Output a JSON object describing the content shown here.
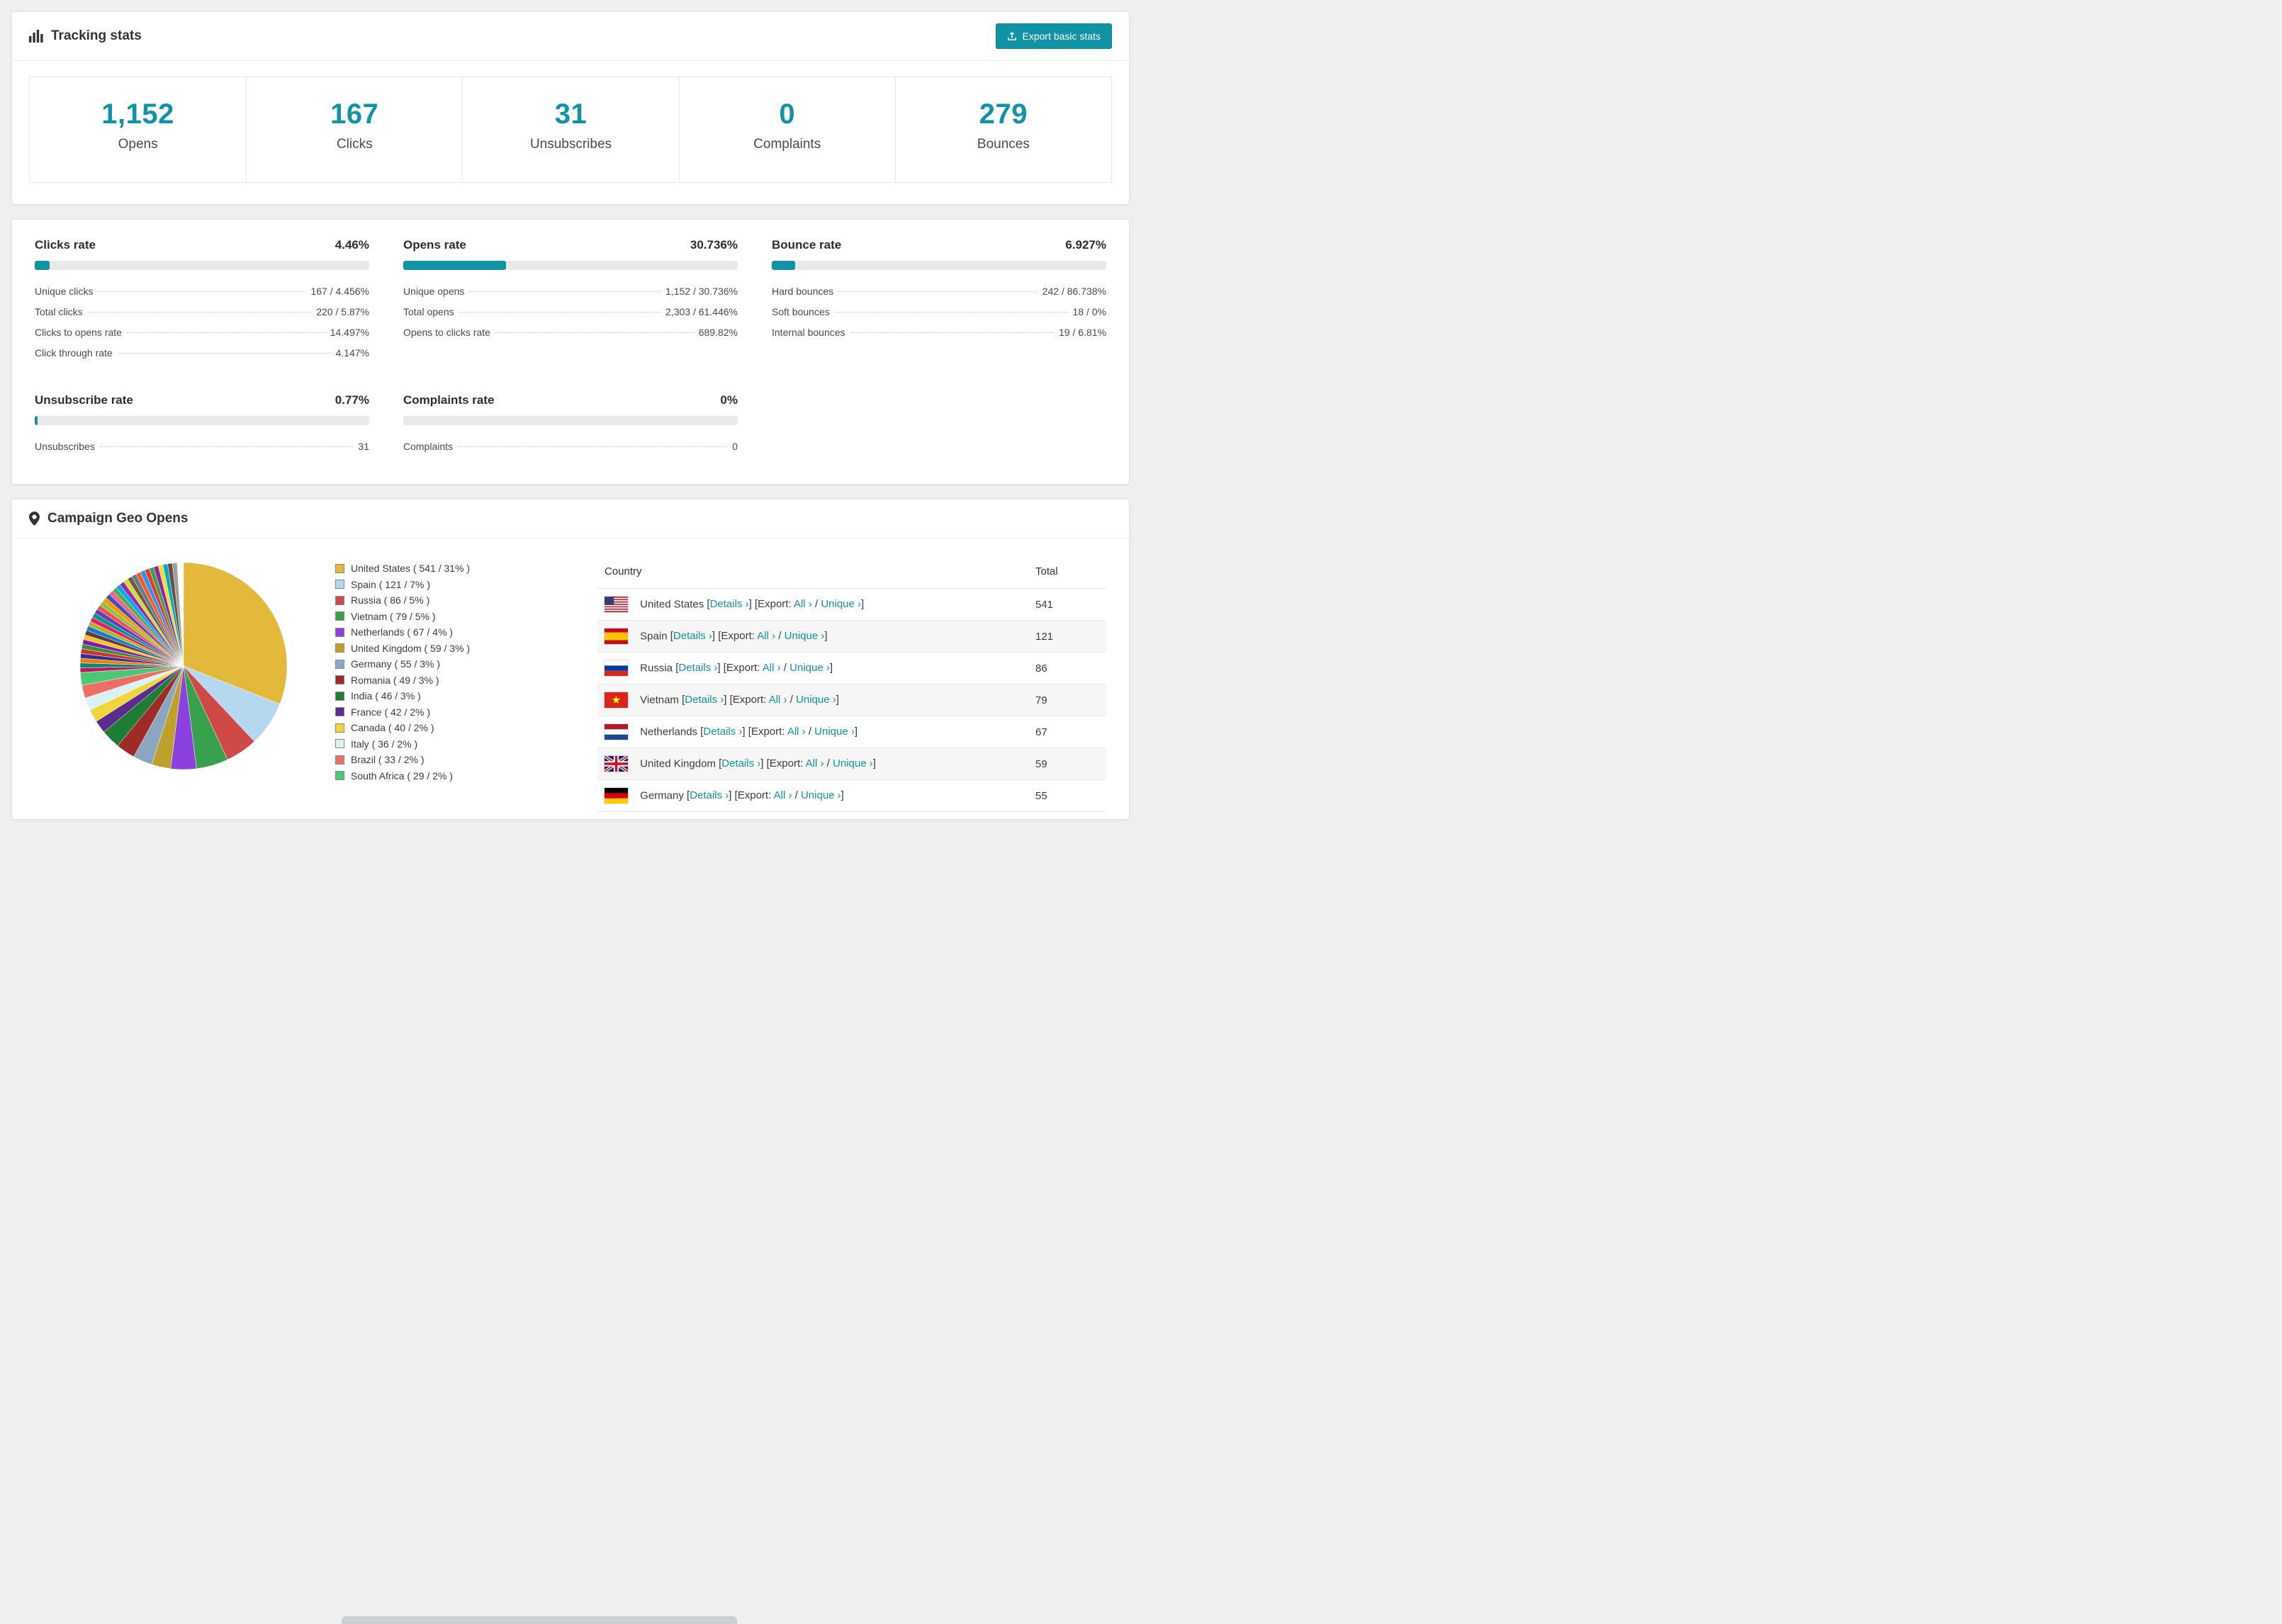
{
  "colors": {
    "accent": "#0f93a5",
    "progress_track": "#e9e9e9"
  },
  "tracking": {
    "title": "Tracking stats",
    "export_label": "Export basic stats",
    "stats": [
      {
        "value": "1,152",
        "label": "Opens"
      },
      {
        "value": "167",
        "label": "Clicks"
      },
      {
        "value": "31",
        "label": "Unsubscribes"
      },
      {
        "value": "0",
        "label": "Complaints"
      },
      {
        "value": "279",
        "label": "Bounces"
      }
    ]
  },
  "rates": {
    "panels": [
      {
        "title": "Clicks rate",
        "value": "4.46%",
        "pct": 4.46,
        "metrics": [
          [
            "Unique clicks",
            "167 / 4.456%"
          ],
          [
            "Total clicks",
            "220 / 5.87%"
          ],
          [
            "Clicks to opens rate",
            "14.497%"
          ],
          [
            "Click through rate",
            "4.147%"
          ]
        ]
      },
      {
        "title": "Opens rate",
        "value": "30.736%",
        "pct": 30.736,
        "metrics": [
          [
            "Unique opens",
            "1,152 / 30.736%"
          ],
          [
            "Total opens",
            "2,303 / 61.446%"
          ],
          [
            "Opens to clicks rate",
            "689.82%"
          ]
        ]
      },
      {
        "title": "Bounce rate",
        "value": "6.927%",
        "pct": 6.927,
        "metrics": [
          [
            "Hard bounces",
            "242 / 86.738%"
          ],
          [
            "Soft bounces",
            "18 / 0%"
          ],
          [
            "Internal bounces",
            "19 / 6.81%"
          ]
        ]
      },
      {
        "title": "Unsubscribe rate",
        "value": "0.77%",
        "pct": 0.77,
        "metrics": [
          [
            "Unsubscribes",
            "31"
          ]
        ]
      },
      {
        "title": "Complaints rate",
        "value": "0%",
        "pct": 0,
        "metrics": [
          [
            "Complaints",
            "0"
          ]
        ]
      }
    ]
  },
  "geo": {
    "title": "Campaign Geo Opens",
    "chart_data": {
      "type": "pie",
      "title": "Campaign Geo Opens",
      "series": [
        {
          "label": "United States",
          "value": 541,
          "pct": 31,
          "color": "#e2b93b"
        },
        {
          "label": "Spain",
          "value": 121,
          "pct": 7,
          "color": "#b5d7f0"
        },
        {
          "label": "Russia",
          "value": 86,
          "pct": 5,
          "color": "#cf4a47"
        },
        {
          "label": "Vietnam",
          "value": 79,
          "pct": 5,
          "color": "#37a14e"
        },
        {
          "label": "Netherlands",
          "value": 67,
          "pct": 4,
          "color": "#8a41dd"
        },
        {
          "label": "United Kingdom",
          "value": 59,
          "pct": 3,
          "color": "#bfa02c"
        },
        {
          "label": "Germany",
          "value": 55,
          "pct": 3,
          "color": "#8ba6c1"
        },
        {
          "label": "Romania",
          "value": 49,
          "pct": 3,
          "color": "#9e2b25"
        },
        {
          "label": "India",
          "value": 46,
          "pct": 3,
          "color": "#1e7c34"
        },
        {
          "label": "France",
          "value": 42,
          "pct": 2,
          "color": "#5b2c8d"
        },
        {
          "label": "Canada",
          "value": 40,
          "pct": 2,
          "color": "#f2d43c"
        },
        {
          "label": "Italy",
          "value": 36,
          "pct": 2,
          "color": "#d9f3f5"
        },
        {
          "label": "Brazil",
          "value": 33,
          "pct": 2,
          "color": "#ee6e66"
        },
        {
          "label": "South Africa",
          "value": 29,
          "pct": 2,
          "color": "#4bc873"
        }
      ],
      "others_pct": 25,
      "others_colors": [
        "#c2185b",
        "#00897b",
        "#f57c00",
        "#283593",
        "#d32f2f",
        "#388e3c",
        "#7b1fa2",
        "#fbc02d",
        "#5d4037",
        "#1976d2",
        "#afb42b",
        "#e91e63",
        "#009688",
        "#673ab7",
        "#ef5350",
        "#8bc34a",
        "#ff9800",
        "#3f51b5",
        "#f06292",
        "#4caf50",
        "#03a9f4",
        "#9c27b0",
        "#cddc39",
        "#795548",
        "#607d8b",
        "#ff5722",
        "#2196f3",
        "#e53935",
        "#43a047",
        "#8e24aa",
        "#fdd835",
        "#00acc1",
        "#6d4c41",
        "#9e9e9e"
      ]
    },
    "table": {
      "headers": [
        "Country",
        "Total"
      ],
      "details_label": "Details ›",
      "export_label": "Export:",
      "all_label": "All ›",
      "unique_label": "Unique ›",
      "punct": {
        "open": "[",
        "close": "]",
        "sep": " / "
      },
      "rows": [
        {
          "country": "United States",
          "flag": "us",
          "total": "541"
        },
        {
          "country": "Spain",
          "flag": "es",
          "total": "121"
        },
        {
          "country": "Russia",
          "flag": "ru",
          "total": "86"
        },
        {
          "country": "Vietnam",
          "flag": "vn",
          "total": "79"
        },
        {
          "country": "Netherlands",
          "flag": "nl",
          "total": "67"
        },
        {
          "country": "United Kingdom",
          "flag": "gb",
          "total": "59"
        },
        {
          "country": "Germany",
          "flag": "de",
          "total": "55"
        }
      ]
    }
  }
}
